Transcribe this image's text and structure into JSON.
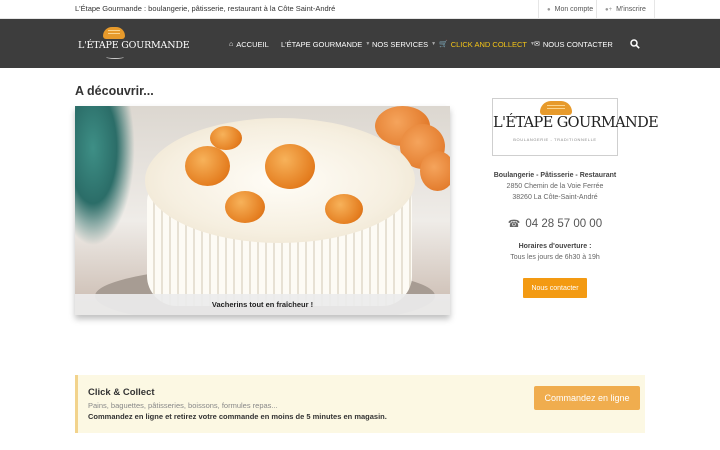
{
  "topbar": {
    "tagline": "L'Étape Gourmande : boulangerie, pâtisserie, restaurant à la Côte Saint-André",
    "login_label": "Mon compte",
    "signup_label": "M'inscrire",
    "login_icon": "user-icon",
    "signup_icon": "user-plus-icon"
  },
  "brand": {
    "logo_text": "L'ÉTAPE GOURMANDE",
    "logo_subtext": "BOULANGERIE - TRADITIONNELLE"
  },
  "nav": {
    "items": [
      {
        "label": "ACCUEIL",
        "icon": "home-icon",
        "dropdown": false
      },
      {
        "label": "L'ÉTAPE GOURMANDE",
        "icon": "",
        "dropdown": true
      },
      {
        "label": "NOS SERVICES",
        "icon": "",
        "dropdown": true
      },
      {
        "label": "CLICK AND COLLECT",
        "icon": "cart-icon",
        "dropdown": true,
        "accent": true
      },
      {
        "label": "NOUS CONTACTER",
        "icon": "envelope-icon",
        "dropdown": false
      }
    ],
    "search_icon": "search-icon",
    "accent_color": "#f5c518",
    "background": "#3d3d3d"
  },
  "main": {
    "section_title": "A découvrir...",
    "hero_caption": "Vacherins tout en fraîcheur !"
  },
  "sidebar": {
    "logo_text": "L'ÉTAPE GOURMANDE",
    "logo_subtext": "BOULANGERIE - TRADITIONNELLE",
    "business_type": "Boulangerie - Pâtisserie - Restaurant",
    "address_line1": "2850 Chemin de la Voie Ferrée",
    "address_line2": "38260 La Côte-Saint-André",
    "phone": "04 28 57 00 00",
    "phone_icon": "phone-icon",
    "hours_title": "Horaires d'ouverture :",
    "hours": "Tous les jours de 6h30 à 19h",
    "contact_button": "Nous contacter",
    "button_color": "#f39a12"
  },
  "click_collect": {
    "title": "Click & Collect",
    "subtitle": "Pains, baguettes, pâtisseries, boissons, formules repas...",
    "description": "Commandez en ligne et retirez votre commande en moins de 5 minutes en magasin.",
    "button": "Commandez en ligne",
    "button_color": "#f0ad4e",
    "background": "#fcf8e3"
  }
}
